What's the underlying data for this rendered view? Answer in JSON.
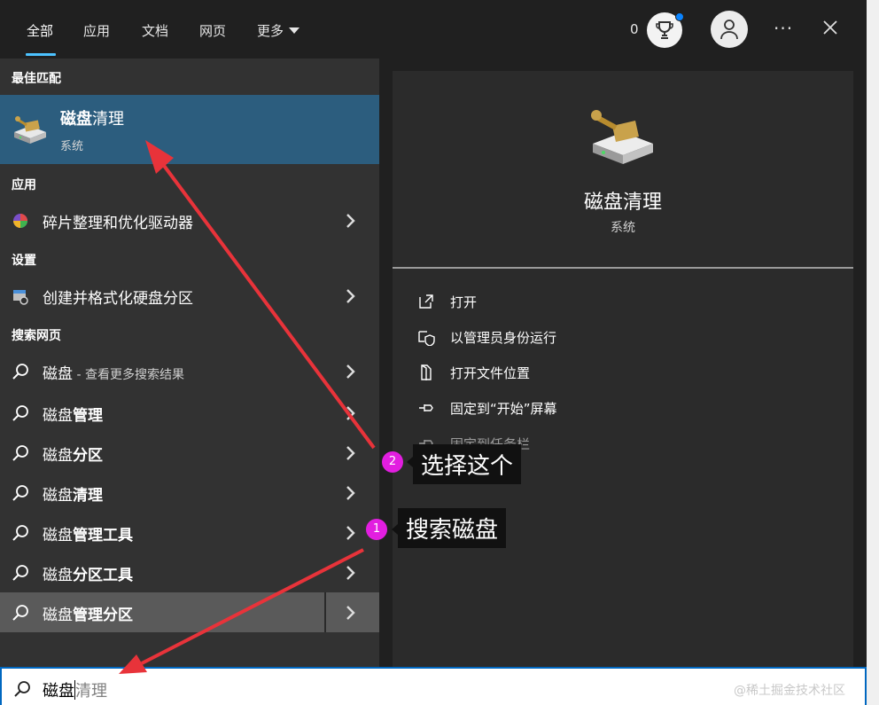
{
  "header": {
    "tabs": [
      {
        "label": "全部"
      },
      {
        "label": "应用"
      },
      {
        "label": "文档"
      },
      {
        "label": "网页"
      },
      {
        "label": "更多"
      }
    ],
    "points": "0",
    "accent": "#4cc2ff"
  },
  "left": {
    "best_match_heading": "最佳匹配",
    "best_match": {
      "title_bold": "磁盘",
      "title_rest": "清理",
      "subtitle": "系统"
    },
    "apps_heading": "应用",
    "apps": [
      {
        "label": "碎片整理和优化驱动器"
      }
    ],
    "settings_heading": "设置",
    "settings": [
      {
        "label": "创建并格式化硬盘分区"
      }
    ],
    "web_heading": "搜索网页",
    "web": [
      {
        "prefix": "磁盘",
        "bold": "",
        "suffix": " - 查看更多搜索结果"
      },
      {
        "prefix": "磁盘",
        "bold": "管理",
        "suffix": ""
      },
      {
        "prefix": "磁盘",
        "bold": "分区",
        "suffix": ""
      },
      {
        "prefix": "磁盘",
        "bold": "清理",
        "suffix": ""
      },
      {
        "prefix": "磁盘",
        "bold": "管理工具",
        "suffix": ""
      },
      {
        "prefix": "磁盘",
        "bold": "分区工具",
        "suffix": ""
      },
      {
        "prefix": "磁盘",
        "bold": "管理分区",
        "suffix": ""
      }
    ]
  },
  "preview": {
    "title": "磁盘清理",
    "subtitle": "系统",
    "actions": [
      {
        "label": "打开",
        "icon": "open-icon"
      },
      {
        "label": "以管理员身份运行",
        "icon": "shield-icon"
      },
      {
        "label": "打开文件位置",
        "icon": "file-location-icon"
      },
      {
        "label": "固定到“开始”屏幕",
        "icon": "pin-icon"
      },
      {
        "label": "固定到任务栏",
        "icon": "pin-icon"
      }
    ]
  },
  "search": {
    "typed": "磁盘",
    "suggestion": "清理"
  },
  "annotations": [
    {
      "number": "2",
      "text": "选择这个"
    },
    {
      "number": "1",
      "text": "搜索磁盘"
    }
  ],
  "watermark": "@稀土掘金技术社区"
}
